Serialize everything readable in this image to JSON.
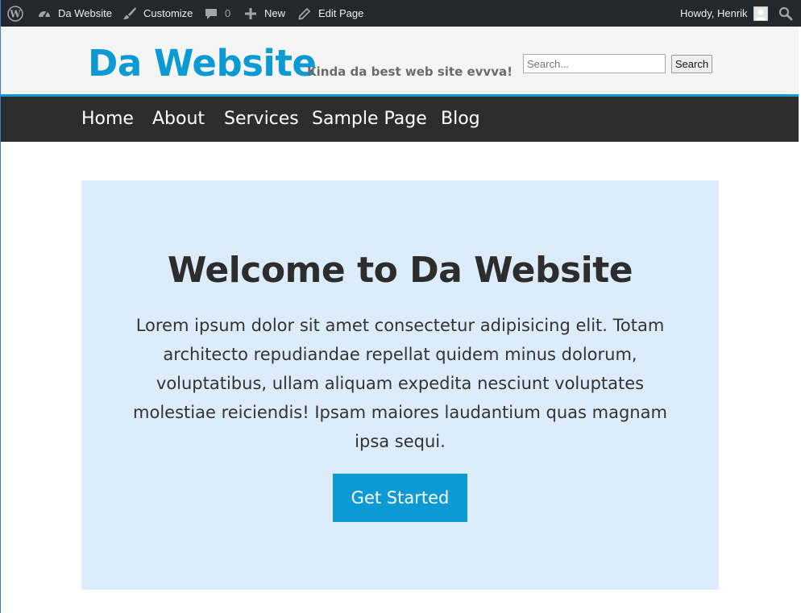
{
  "adminbar": {
    "site_name": "Da Website",
    "customize": "Customize",
    "comments_count": "0",
    "new": "New",
    "edit_page": "Edit Page",
    "howdy": "Howdy, Henrik"
  },
  "header": {
    "site_title": "Da Website",
    "tagline": "Kinda da best web site evvva!",
    "search_placeholder": "Search...",
    "search_button": "Search"
  },
  "nav": {
    "items": [
      {
        "label": "Home"
      },
      {
        "label": "About"
      },
      {
        "label": "Services"
      },
      {
        "label": "Sample Page"
      },
      {
        "label": "Blog"
      }
    ]
  },
  "hero": {
    "title": "Welcome to Da Website",
    "text": "Lorem ipsum dolor sit amet consectetur adipisicing elit. Totam architecto repudiandae repellat quidem minus dolorum, voluptatibus, ullam aliquam expedita nesciunt voluptates molestiae reiciendis! Ipsam maiores laudantium quas magnam ipsa sequi.",
    "button": "Get Started"
  },
  "colors": {
    "admin_bar": "#23282d",
    "accent": "#0b9ad3",
    "nav": "#2d2d2d",
    "hero_bg": "#ddecfa",
    "header_bg": "#f5f5f5"
  },
  "icons": [
    "wordpress-icon",
    "dashboard-icon",
    "brush-icon",
    "comment-icon",
    "plus-icon",
    "pencil-icon",
    "avatar",
    "search-icon"
  ]
}
